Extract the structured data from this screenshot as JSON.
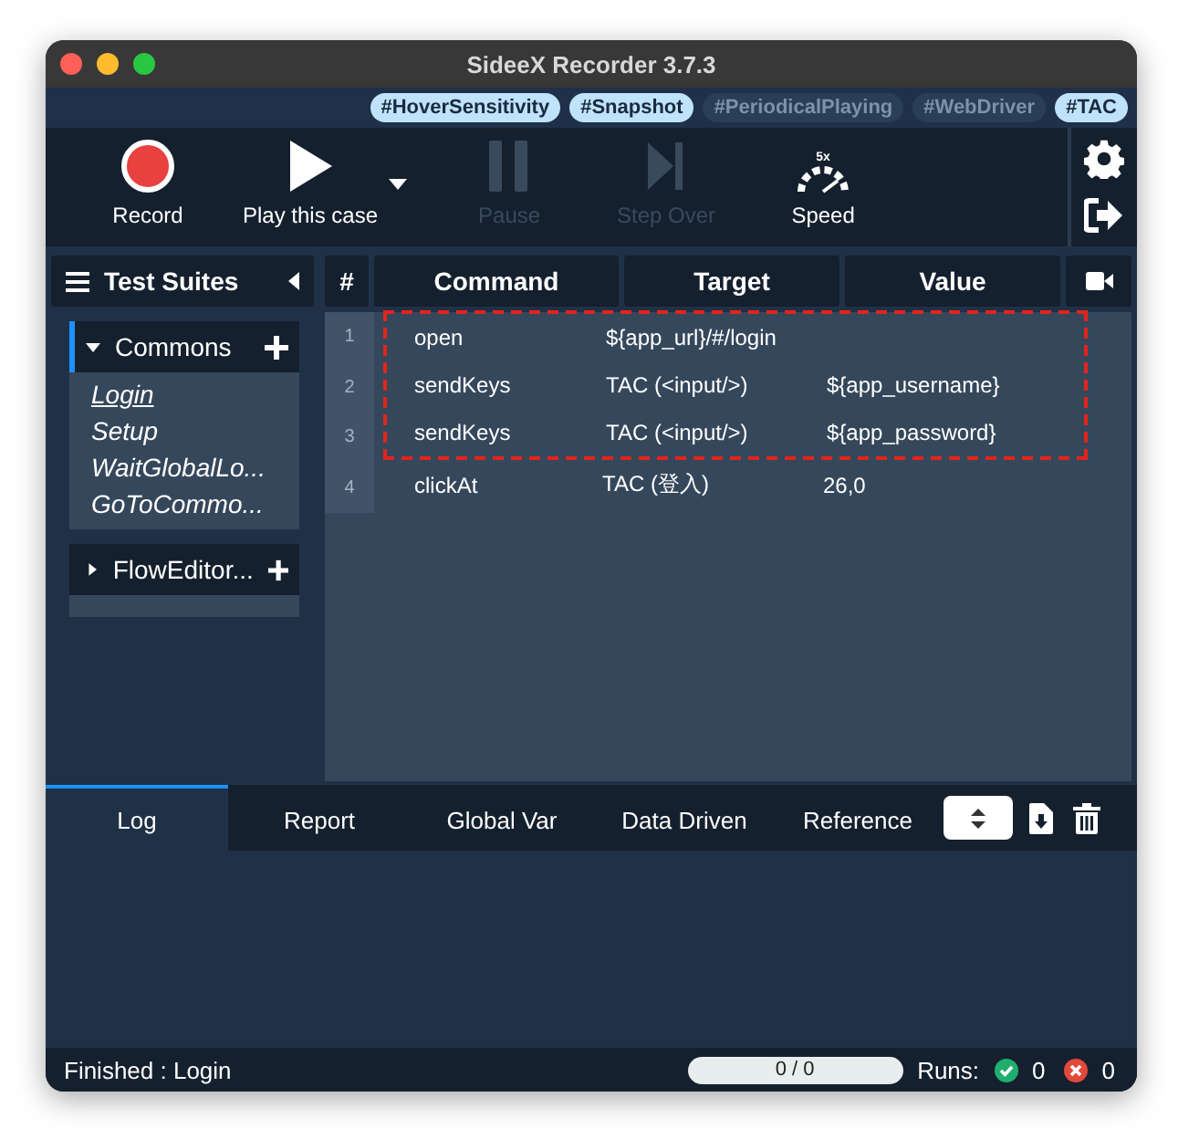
{
  "window": {
    "title": "SideeX Recorder 3.7.3"
  },
  "tags": [
    {
      "label": "#HoverSensitivity",
      "on": true
    },
    {
      "label": "#Snapshot",
      "on": true
    },
    {
      "label": "#PeriodicalPlaying",
      "on": false
    },
    {
      "label": "#WebDriver",
      "on": false
    },
    {
      "label": "#TAC",
      "on": true
    }
  ],
  "toolbar": [
    {
      "kind": "record",
      "label": "Record",
      "disabled": false
    },
    {
      "kind": "play",
      "label": "Play this case",
      "disabled": false
    },
    {
      "kind": "pause",
      "label": "Pause",
      "disabled": true
    },
    {
      "kind": "step",
      "label": "Step Over",
      "disabled": true
    },
    {
      "kind": "speed",
      "label": "Speed",
      "badge": "5x",
      "disabled": false
    }
  ],
  "sidebar": {
    "title": "Test Suites",
    "suites": [
      {
        "name": "Commons",
        "expanded": true,
        "selected": true,
        "cases": [
          {
            "name": "Login",
            "selected": true
          },
          {
            "name": "Setup",
            "selected": false
          },
          {
            "name": "WaitGlobalLo...",
            "selected": false
          },
          {
            "name": "GoToCommo...",
            "selected": false
          }
        ]
      },
      {
        "name": "FlowEditor...",
        "expanded": false,
        "selected": false
      }
    ]
  },
  "table": {
    "columns": [
      "#",
      "Command",
      "Target",
      "Value"
    ],
    "rows": [
      {
        "index": "1",
        "command": "open",
        "target": "${app_url}/#/login",
        "value": "",
        "boxed": true
      },
      {
        "index": "2",
        "command": "sendKeys",
        "target": "TAC (<input/>)",
        "value": "${app_username}",
        "boxed": true
      },
      {
        "index": "3",
        "command": "sendKeys",
        "target": "TAC (<input/>)",
        "value": "${app_password}",
        "boxed": true
      },
      {
        "index": "4",
        "command": "clickAt",
        "target": "TAC (登入)",
        "value": "26,0",
        "boxed": false
      }
    ]
  },
  "bottom_tabs": [
    {
      "label": "Log",
      "selected": true
    },
    {
      "label": "Report",
      "selected": false
    },
    {
      "label": "Global Var",
      "selected": false
    },
    {
      "label": "Data Driven",
      "selected": false
    },
    {
      "label": "Reference",
      "selected": false
    }
  ],
  "status_bar": {
    "message": "Finished : Login",
    "progress": {
      "text": "0 / 0",
      "level": 0
    },
    "runs_label": "Runs:",
    "passed": "0",
    "failed": "0"
  }
}
